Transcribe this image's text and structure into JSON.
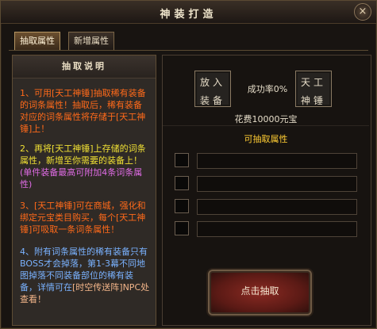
{
  "window": {
    "title": "神装打造",
    "close_icon": "×"
  },
  "tabs": [
    {
      "label": "抽取属性",
      "active": true
    },
    {
      "label": "新增属性",
      "active": false
    }
  ],
  "left": {
    "header": "抽取说明",
    "p1": "1、可用[天工神锤]抽取稀有装备的词条属性！抽取后，稀有装备对应的词条属性将存储于[天工神锤]上！",
    "p2": "2、再将[天工神锤]上存储的词条属性，新增至你需要的装备上！",
    "p2_extra": "(单件装备最高可附加4条词条属性)",
    "p3": "3、[天工神锤]可在商城，强化和绑定元宝类目购买，每个[天工神锤]可吸取一条词条属性！",
    "p4": "4、附有词条属性的稀有装备只有BOSS才会掉落，第1-3幕不同地图掉落不同装备部位的稀有装备，详情可在",
    "p4_extra": "[时空传送阵]NPC处查看！"
  },
  "right": {
    "slot_equip_line1": "放入",
    "slot_equip_line2": "装备",
    "success_rate": "成功率0%",
    "slot_hammer_line1": "天工",
    "slot_hammer_line2": "神锤",
    "cost": "花费10000元宝",
    "available_title": "可抽取属性",
    "extract_button": "点击抽取"
  }
}
